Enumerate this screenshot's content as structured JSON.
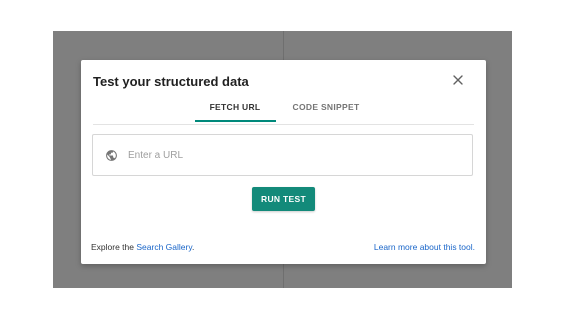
{
  "dialog": {
    "title": "Test your structured data",
    "close_icon": "close-icon"
  },
  "tabs": [
    {
      "label": "FETCH URL",
      "active": true
    },
    {
      "label": "CODE SNIPPET",
      "active": false
    }
  ],
  "url_field": {
    "icon": "globe-icon",
    "placeholder": "Enter a URL",
    "value": ""
  },
  "run_button": {
    "label": "RUN TEST"
  },
  "footer": {
    "explore_prefix": "Explore the ",
    "gallery_link": "Search Gallery",
    "explore_suffix": ".",
    "learn_more_link": "Learn more about this tool."
  },
  "colors": {
    "accent": "#00897b",
    "button": "#138a7a",
    "link": "#1a66c9",
    "backdrop": "#7f7f7f"
  }
}
